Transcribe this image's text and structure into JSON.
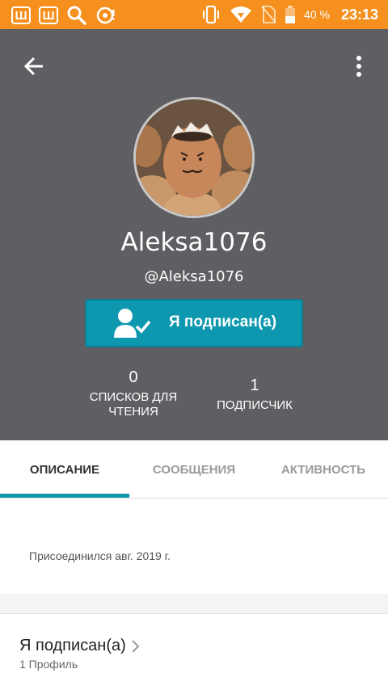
{
  "status_bar": {
    "app_icon_1": "Ш",
    "app_icon_2": "Ш",
    "battery_percent": "40 %",
    "time": "23:13"
  },
  "toolbar": {
    "back_icon": "arrow-left-icon",
    "more_icon": "more-vertical-icon"
  },
  "profile": {
    "username": "Aleksa1076",
    "handle": "@Aleksa1076",
    "follow_button_label": "Я подписан(а)",
    "stats": {
      "reading_lists_count": "0",
      "reading_lists_label_line1": "СПИСКОВ ДЛЯ",
      "reading_lists_label_line2": "ЧТЕНИЯ",
      "followers_count": "1",
      "followers_label": "ПОДПИСЧИК"
    }
  },
  "tabs": [
    {
      "label": "ОПИСАНИЕ",
      "active": true
    },
    {
      "label": "СООБЩЕНИЯ",
      "active": false
    },
    {
      "label": "АКТИВНОСТЬ",
      "active": false
    }
  ],
  "description": {
    "joined_text": "Присоединился авг. 2019 г."
  },
  "following": {
    "title": "Я подписан(а)",
    "count_text": "1 Профиль"
  },
  "colors": {
    "status_bar": "#F5901E",
    "header_bg": "#5F5E62",
    "accent": "#0E98AF"
  }
}
